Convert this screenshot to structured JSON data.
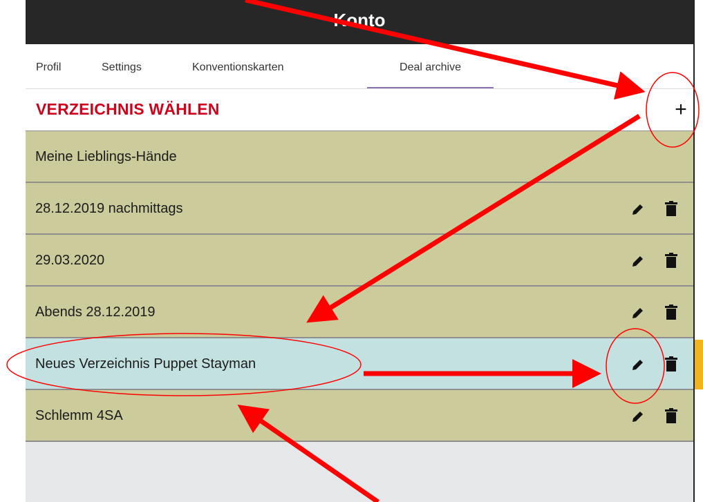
{
  "header": {
    "title": "Konto"
  },
  "tabs": [
    {
      "label": "Profil"
    },
    {
      "label": "Settings"
    },
    {
      "label": "Konventionskarten"
    },
    {
      "label": "Deal archive"
    }
  ],
  "section": {
    "title": "VERZEICHNIS WÄHLEN",
    "add_icon": "plus-icon",
    "add_label": "+"
  },
  "directories": [
    {
      "label": "Meine Lieblings-Hände"
    },
    {
      "label": "28.12.2019 nachmittags"
    },
    {
      "label": "29.03.2020"
    },
    {
      "label": "Abends 28.12.2019"
    },
    {
      "label": "Neues Verzeichnis Puppet Stayman"
    },
    {
      "label": "Schlemm 4SA"
    }
  ],
  "colors": {
    "header_bg": "#272727",
    "section_title": "#d0021b",
    "row_bg": "#cccb9c",
    "row_selected_bg": "#c4e1e2",
    "tab_active_underline": "#8b73b8",
    "annotation": "#ff0000"
  },
  "icons": {
    "edit": "pencil-icon",
    "delete": "trash-icon"
  }
}
